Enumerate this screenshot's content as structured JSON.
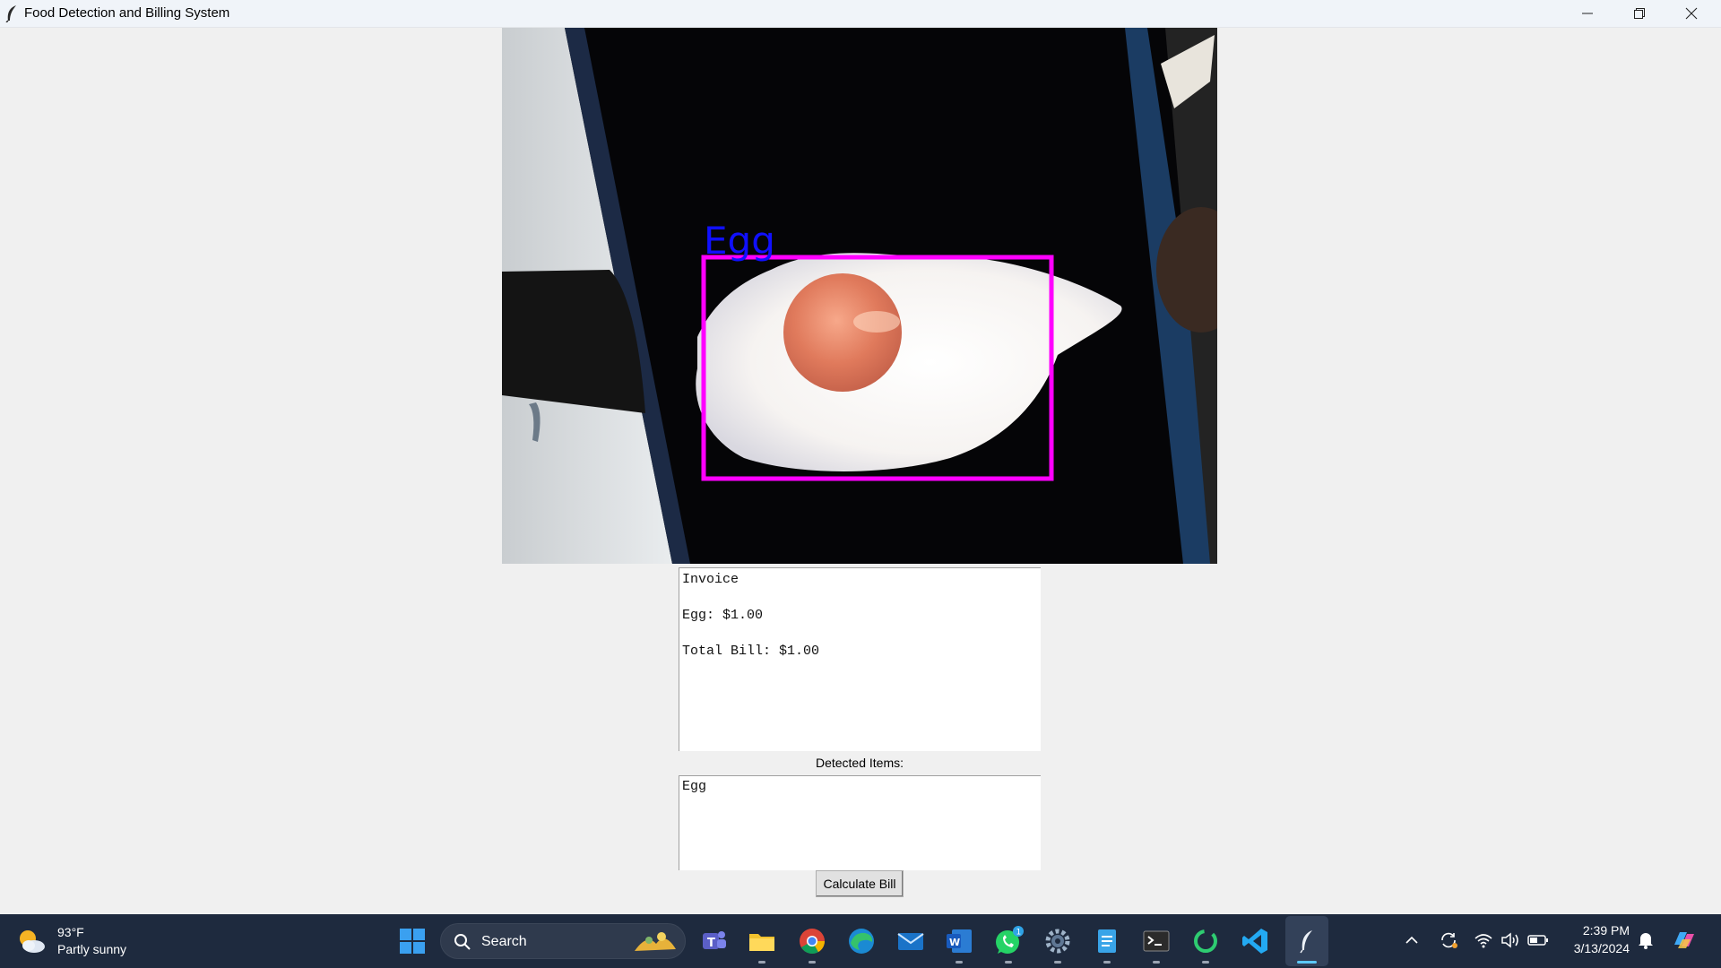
{
  "window": {
    "title": "Food Detection and Billing System"
  },
  "camera": {
    "detection_label": "Egg",
    "box_color": "#ff00ff",
    "label_color": "#1010ff"
  },
  "invoice": {
    "heading": "Invoice",
    "line_item": "Egg: $1.00",
    "total": "Total Bill: $1.00"
  },
  "detected": {
    "label": "Detected Items:",
    "items": "Egg"
  },
  "actions": {
    "calculate_label": "Calculate Bill"
  },
  "taskbar": {
    "weather_temp": "93°F",
    "weather_desc": "Partly sunny",
    "search_placeholder": "Search",
    "whatsapp_badge": "1",
    "clock_time": "2:39 PM",
    "clock_date": "3/13/2024",
    "accent": "#5cc8f7"
  }
}
